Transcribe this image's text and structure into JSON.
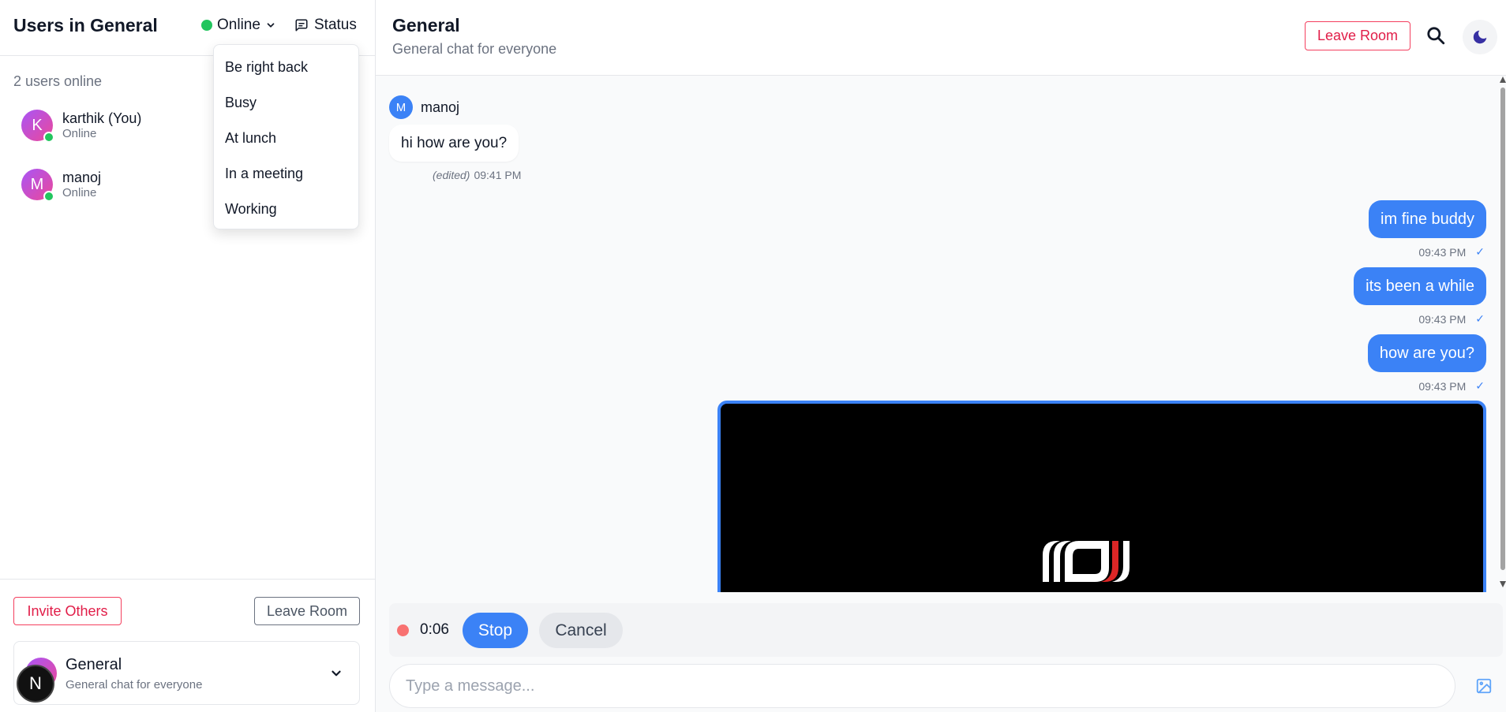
{
  "sidebar": {
    "title": "Users in General",
    "presence": {
      "label": "Online",
      "color": "#22c55e"
    },
    "status_button": "Status",
    "status_menu": [
      "Be right back",
      "Busy",
      "At lunch",
      "In a meeting",
      "Working"
    ],
    "online_count": "2 users online",
    "users": [
      {
        "initial": "K",
        "name": "karthik (You)",
        "status": "Online"
      },
      {
        "initial": "M",
        "name": "manoj",
        "status": "Online"
      }
    ],
    "invite_button": "Invite Others",
    "leave_button": "Leave Room",
    "room_card": {
      "name": "General",
      "description": "General chat for everyone"
    },
    "n_badge": "N"
  },
  "header": {
    "title": "General",
    "subtitle": "General chat for everyone",
    "leave_button": "Leave Room"
  },
  "messages": {
    "incoming": {
      "sender_initial": "M",
      "sender_name": "manoj",
      "text": "hi how are you?",
      "edited_label": "(edited)",
      "time": "09:41 PM"
    },
    "outgoing": [
      {
        "text": "im fine buddy",
        "time": "09:43 PM",
        "tick": "✓"
      },
      {
        "text": "its been a while",
        "time": "09:43 PM",
        "tick": "✓"
      },
      {
        "text": "how are you?",
        "time": "09:43 PM",
        "tick": "✓"
      }
    ]
  },
  "recorder": {
    "elapsed": "0:06",
    "stop_label": "Stop",
    "cancel_label": "Cancel"
  },
  "composer": {
    "placeholder": "Type a message..."
  },
  "colors": {
    "accent": "#3b82f6",
    "danger": "#e11d48",
    "online": "#22c55e",
    "recording": "#f87171"
  }
}
